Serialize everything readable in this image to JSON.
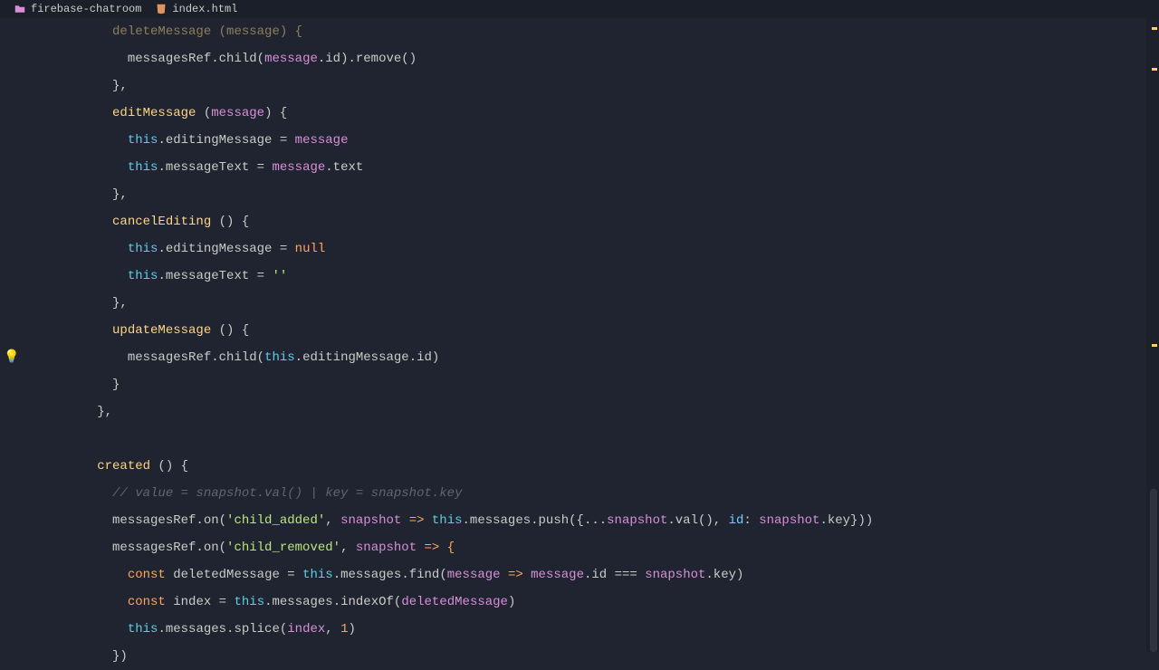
{
  "tabs": {
    "project": "firebase-chatroom",
    "file": "index.html"
  },
  "code": {
    "l1": "deleteMessage (message) {",
    "l2_a": "messagesRef.child(",
    "l2_b": "message",
    "l2_c": ".id).remove()",
    "l3": "},",
    "l4_a": "editMessage",
    "l4_b": " (",
    "l4_c": "message",
    "l4_d": ") {",
    "l5_a": "this",
    "l5_b": ".editingMessage = ",
    "l5_c": "message",
    "l6_a": "this",
    "l6_b": ".messageText = ",
    "l6_c": "message",
    "l6_d": ".text",
    "l7": "},",
    "l8_a": "cancelEditing",
    "l8_b": " () {",
    "l9_a": "this",
    "l9_b": ".editingMessage = ",
    "l9_c": "null",
    "l10_a": "this",
    "l10_b": ".messageText = ",
    "l10_c": "''",
    "l11": "},",
    "l12_a": "updateMessage",
    "l12_b": " () {",
    "l13_a": "messagesRef.child(",
    "l13_b": "this",
    "l13_c": ".editingMessage.id)",
    "l14": "}",
    "l15": "},",
    "l16_a": "created",
    "l16_b": " () {",
    "l17": "// value = snapshot.val() | key = snapshot.key",
    "l18_a": "messagesRef.on(",
    "l18_b": "'child_added'",
    "l18_c": ", ",
    "l18_d": "snapshot",
    "l18_e": " => ",
    "l18_f": "this",
    "l18_g": ".messages.push({...",
    "l18_h": "snapshot",
    "l18_i": ".val(), ",
    "l18_j": "id",
    "l18_k": ": ",
    "l18_l": "snapshot",
    "l18_m": ".key}))",
    "l19_a": "messagesRef.on(",
    "l19_b": "'child_removed'",
    "l19_c": ", ",
    "l19_d": "snapshot",
    "l19_e": " => {",
    "l20_a": "const ",
    "l20_b": "deletedMessage",
    "l20_c": " = ",
    "l20_d": "this",
    "l20_e": ".messages.find(",
    "l20_f": "message",
    "l20_g": " => ",
    "l20_h": "message",
    "l20_i": ".id === ",
    "l20_j": "snapshot",
    "l20_k": ".key)",
    "l21_a": "const ",
    "l21_b": "index",
    "l21_c": " = ",
    "l21_d": "this",
    "l21_e": ".messages.indexOf(",
    "l21_f": "deletedMessage",
    "l21_g": ")",
    "l22_a": "this",
    "l22_b": ".messages.splice(",
    "l22_c": "index",
    "l22_d": ", ",
    "l22_e": "1",
    "l22_f": ")",
    "l23": "})"
  }
}
